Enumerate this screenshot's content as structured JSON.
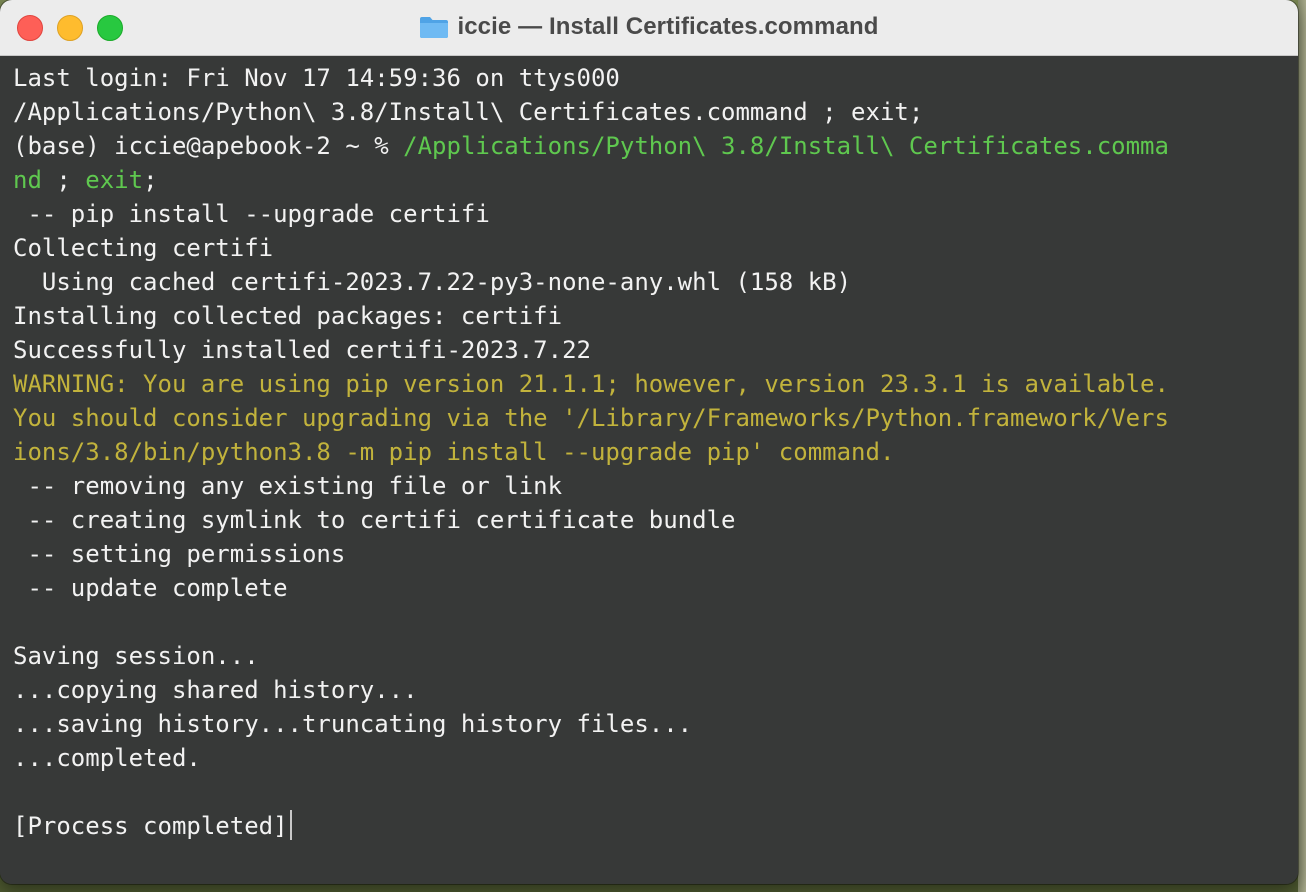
{
  "window": {
    "title": "iccie — Install Certificates.command",
    "title_icon": "folder-icon",
    "controls": {
      "close": "close-button",
      "minimize": "minimize-button",
      "zoom": "zoom-button"
    },
    "colors": {
      "background": "#373938",
      "text": "#f2f2f2",
      "green": "#5fc84f",
      "yellow": "#c2b33c"
    }
  },
  "terminal": {
    "lines": [
      {
        "segments": [
          {
            "text": "Last login: Fri Nov 17 14:59:36 on ttys000",
            "color": "default"
          }
        ]
      },
      {
        "segments": [
          {
            "text": "/Applications/Python\\ 3.8/Install\\ Certificates.command ; exit;",
            "color": "default"
          }
        ]
      },
      {
        "segments": [
          {
            "text": "(base) iccie@apebook-2 ~ % ",
            "color": "default"
          },
          {
            "text": "/Applications/Python\\ 3.8/Install\\ Certificates.comma",
            "color": "green"
          }
        ]
      },
      {
        "segments": [
          {
            "text": "nd",
            "color": "green"
          },
          {
            "text": " ; ",
            "color": "default"
          },
          {
            "text": "exit",
            "color": "green"
          },
          {
            "text": ";",
            "color": "default"
          }
        ]
      },
      {
        "segments": [
          {
            "text": " -- pip install --upgrade certifi",
            "color": "default"
          }
        ]
      },
      {
        "segments": [
          {
            "text": "Collecting certifi",
            "color": "default"
          }
        ]
      },
      {
        "segments": [
          {
            "text": "  Using cached certifi-2023.7.22-py3-none-any.whl (158 kB)",
            "color": "default"
          }
        ]
      },
      {
        "segments": [
          {
            "text": "Installing collected packages: certifi",
            "color": "default"
          }
        ]
      },
      {
        "segments": [
          {
            "text": "Successfully installed certifi-2023.7.22",
            "color": "default"
          }
        ]
      },
      {
        "segments": [
          {
            "text": "WARNING: You are using pip version 21.1.1; however, version 23.3.1 is available.",
            "color": "yellow"
          }
        ]
      },
      {
        "segments": [
          {
            "text": "You should consider upgrading via the '/Library/Frameworks/Python.framework/Vers",
            "color": "yellow"
          }
        ]
      },
      {
        "segments": [
          {
            "text": "ions/3.8/bin/python3.8 -m pip install --upgrade pip' command.",
            "color": "yellow"
          }
        ]
      },
      {
        "segments": [
          {
            "text": " -- removing any existing file or link",
            "color": "default"
          }
        ]
      },
      {
        "segments": [
          {
            "text": " -- creating symlink to certifi certificate bundle",
            "color": "default"
          }
        ]
      },
      {
        "segments": [
          {
            "text": " -- setting permissions",
            "color": "default"
          }
        ]
      },
      {
        "segments": [
          {
            "text": " -- update complete",
            "color": "default"
          }
        ]
      },
      {
        "segments": [
          {
            "text": "",
            "color": "default"
          }
        ]
      },
      {
        "segments": [
          {
            "text": "Saving session...",
            "color": "default"
          }
        ]
      },
      {
        "segments": [
          {
            "text": "...copying shared history...",
            "color": "default"
          }
        ]
      },
      {
        "segments": [
          {
            "text": "...saving history...truncating history files...",
            "color": "default"
          }
        ]
      },
      {
        "segments": [
          {
            "text": "...completed.",
            "color": "default"
          }
        ]
      },
      {
        "segments": [
          {
            "text": "",
            "color": "default"
          }
        ]
      },
      {
        "segments": [
          {
            "text": "[Process completed]",
            "color": "default"
          }
        ],
        "cursor": true
      }
    ]
  }
}
